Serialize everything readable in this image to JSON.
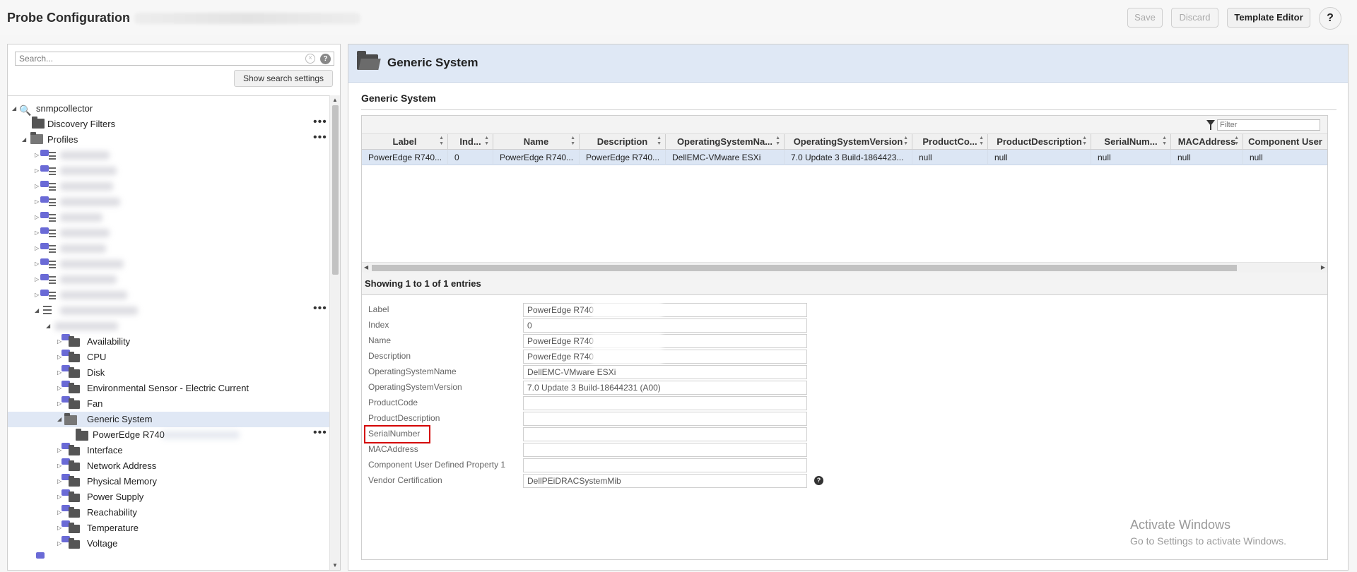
{
  "app": {
    "title": "Probe Configuration",
    "title_sep": "-"
  },
  "toolbar": {
    "save_label": "Save",
    "discard_label": "Discard",
    "template_editor_label": "Template Editor",
    "help_label": "?"
  },
  "left": {
    "search_placeholder": "Search...",
    "show_search_label": "Show search settings",
    "more_label": "•••",
    "tree": {
      "root": "snmpcollector",
      "discovery_filters": "Discovery Filters",
      "profiles": "Profiles",
      "availability": "Availability",
      "cpu": "CPU",
      "disk": "Disk",
      "env_sensor": "Environmental Sensor - Electric Current",
      "fan": "Fan",
      "generic_system": "Generic System",
      "poweredge": "PowerEdge R740",
      "interface": "Interface",
      "network_address": "Network Address",
      "physical_memory": "Physical Memory",
      "power_supply": "Power Supply",
      "reachability": "Reachability",
      "temperature": "Temperature",
      "voltage": "Voltage"
    }
  },
  "right": {
    "header_title": "Generic System",
    "section_title": "Generic System",
    "filter_placeholder": "Filter",
    "columns": [
      "Label",
      "Ind...",
      "Name",
      "Description",
      "OperatingSystemNa...",
      "OperatingSystemVersion",
      "ProductCo...",
      "ProductDescription",
      "SerialNum...",
      "MACAddress",
      "Component User"
    ],
    "row": [
      "PowerEdge R740...",
      "0",
      "PowerEdge R740...",
      "PowerEdge R740...",
      "DellEMC-VMware ESXi",
      "7.0 Update 3 Build-1864423...",
      "null",
      "null",
      "null",
      "null",
      "null"
    ],
    "entries_text": "Showing 1 to 1 of 1 entries",
    "form": {
      "label": {
        "label": "Label",
        "value": "PowerEdge R740"
      },
      "index": {
        "label": "Index",
        "value": "0"
      },
      "name": {
        "label": "Name",
        "value": "PowerEdge R740"
      },
      "description": {
        "label": "Description",
        "value": "PowerEdge R740"
      },
      "os_name": {
        "label": "OperatingSystemName",
        "value": "DellEMC-VMware ESXi"
      },
      "os_version": {
        "label": "OperatingSystemVersion",
        "value": "7.0 Update 3 Build-18644231 (A00)"
      },
      "product_code": {
        "label": "ProductCode",
        "value": ""
      },
      "product_description": {
        "label": "ProductDescription",
        "value": ""
      },
      "serial_number": {
        "label": "SerialNumber",
        "value": ""
      },
      "mac_address": {
        "label": "MACAddress",
        "value": ""
      },
      "component_udp1": {
        "label": "Component User Defined Property 1",
        "value": ""
      },
      "vendor_cert": {
        "label": "Vendor Certification",
        "value": "DellPEiDRACSystemMib"
      }
    }
  },
  "watermark": {
    "line1": "Activate Windows",
    "line2": "Go to Settings to activate Windows."
  }
}
